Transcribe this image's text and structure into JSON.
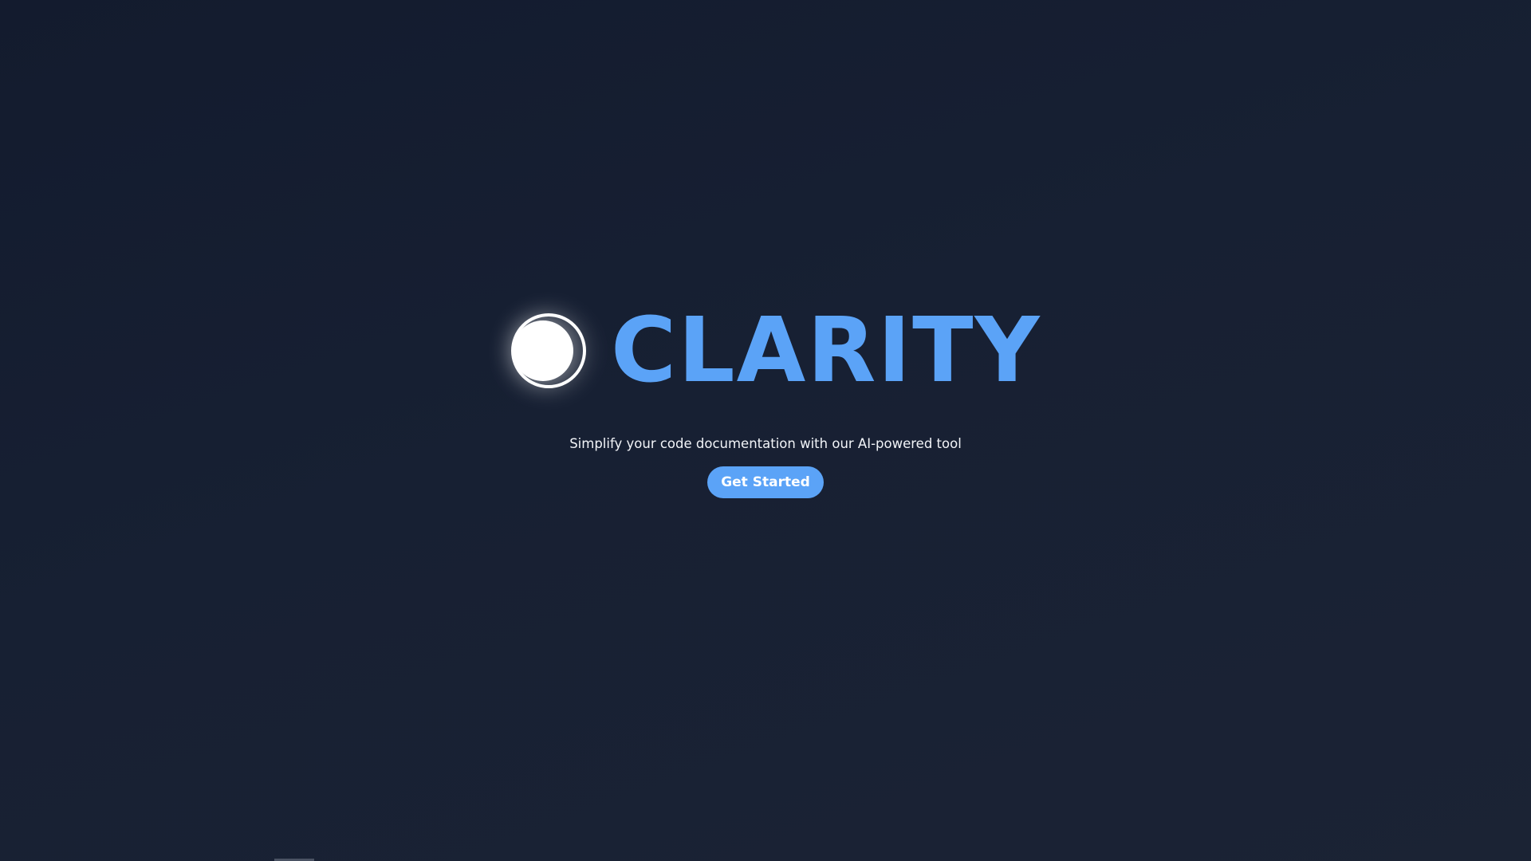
{
  "hero": {
    "logo_icon": "crescent-moon-icon",
    "brand_name": "CLARITY",
    "tagline": "Simplify your code documentation with our AI-powered tool",
    "cta_label": "Get Started"
  },
  "colors": {
    "background": "#151d2f",
    "accent": "#5ba3f7",
    "text": "#ffffff"
  }
}
